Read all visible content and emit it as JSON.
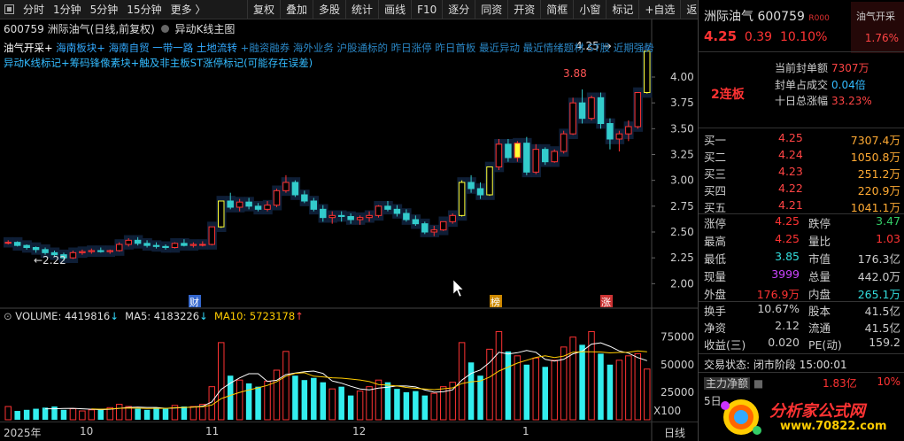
{
  "toolbar": {
    "periods": [
      "分时",
      "1分钟",
      "5分钟",
      "15分钟",
      "更多 〉"
    ],
    "buttons": [
      "复权",
      "叠加",
      "多股",
      "统计",
      "画线",
      "F10",
      "逐分",
      "同资",
      "开资",
      "简框",
      "小窗",
      "标记",
      "+自选",
      "返回"
    ]
  },
  "chart": {
    "title_code": "600759",
    "title_name": "洲际油气(日线,前复权)",
    "indicator": "异动K线主图",
    "concepts_row1": [
      {
        "text": "油气开采+",
        "color": "#ffffff"
      },
      {
        "text": "海南板块+",
        "color": "#33aaff"
      },
      {
        "text": "海南自贸 ",
        "color": "#33aaff"
      },
      {
        "text": "一带一路 ",
        "color": "#33aaff"
      },
      {
        "text": "土地流转",
        "color": "#33aaff"
      },
      {
        "text": "+融资融券 海外业务 沪股通标的 昨日涨停 昨日首板 最近异动 最近情绪题材 ST股 近期强势",
        "color": "#2a86c4"
      }
    ],
    "concepts_row2": "异动K线标记+筹码锋像素块+触及非主板ST涨停标记(可能存在误差)",
    "max_label": "4.25",
    "peak_label": "3.88",
    "low_label": "2.22",
    "event_labels": [
      "财",
      "榜",
      "涨"
    ],
    "price_ticks": [
      "4.00",
      "3.75",
      "3.50",
      "3.25",
      "3.00",
      "2.75",
      "2.50",
      "2.25",
      "2.00"
    ],
    "volume": {
      "label": "VOLUME:",
      "value": "4419816",
      "ma5_label": "MA5:",
      "ma5": "4183226",
      "ma10_label": "MA10:",
      "ma10": "5723178",
      "ticks": [
        "75000",
        "50000",
        "25000"
      ],
      "unit": "X100"
    },
    "date_ticks": [
      "2025年",
      "10",
      "11",
      "12",
      "1"
    ],
    "date_unit": "日线"
  },
  "chart_data": {
    "type": "candlestick",
    "symbol": "600759",
    "ylim": [
      1.9,
      4.3
    ],
    "candles": [
      [
        2.4,
        2.42,
        2.38,
        2.4
      ],
      [
        2.4,
        2.41,
        2.36,
        2.37
      ],
      [
        2.37,
        2.38,
        2.33,
        2.35
      ],
      [
        2.35,
        2.36,
        2.3,
        2.33
      ],
      [
        2.33,
        2.35,
        2.28,
        2.3
      ],
      [
        2.3,
        2.32,
        2.26,
        2.28
      ],
      [
        2.28,
        2.3,
        2.22,
        2.25
      ],
      [
        2.25,
        2.32,
        2.24,
        2.3
      ],
      [
        2.3,
        2.33,
        2.28,
        2.31
      ],
      [
        2.31,
        2.34,
        2.29,
        2.32
      ],
      [
        2.32,
        2.35,
        2.3,
        2.31
      ],
      [
        2.31,
        2.33,
        2.29,
        2.32
      ],
      [
        2.32,
        2.4,
        2.31,
        2.38
      ],
      [
        2.38,
        2.44,
        2.36,
        2.42
      ],
      [
        2.42,
        2.45,
        2.37,
        2.39
      ],
      [
        2.39,
        2.42,
        2.35,
        2.37
      ],
      [
        2.37,
        2.4,
        2.34,
        2.36
      ],
      [
        2.36,
        2.38,
        2.33,
        2.35
      ],
      [
        2.35,
        2.4,
        2.34,
        2.39
      ],
      [
        2.39,
        2.43,
        2.36,
        2.37
      ],
      [
        2.37,
        2.4,
        2.35,
        2.38
      ],
      [
        2.38,
        2.41,
        2.36,
        2.38
      ],
      [
        2.38,
        2.55,
        2.37,
        2.55
      ],
      [
        2.55,
        2.8,
        2.54,
        2.8
      ],
      [
        2.8,
        2.88,
        2.72,
        2.74
      ],
      [
        2.74,
        2.82,
        2.7,
        2.79
      ],
      [
        2.79,
        2.83,
        2.72,
        2.75
      ],
      [
        2.75,
        2.78,
        2.7,
        2.72
      ],
      [
        2.72,
        2.8,
        2.7,
        2.76
      ],
      [
        2.76,
        2.92,
        2.74,
        2.9
      ],
      [
        2.9,
        3.05,
        2.88,
        2.98
      ],
      [
        2.98,
        3.0,
        2.84,
        2.86
      ],
      [
        2.86,
        2.9,
        2.78,
        2.8
      ],
      [
        2.8,
        2.83,
        2.7,
        2.72
      ],
      [
        2.72,
        2.76,
        2.6,
        2.64
      ],
      [
        2.64,
        2.7,
        2.58,
        2.66
      ],
      [
        2.66,
        2.7,
        2.6,
        2.65
      ],
      [
        2.65,
        2.68,
        2.58,
        2.62
      ],
      [
        2.62,
        2.66,
        2.57,
        2.64
      ],
      [
        2.64,
        2.7,
        2.6,
        2.66
      ],
      [
        2.66,
        2.76,
        2.64,
        2.75
      ],
      [
        2.75,
        2.8,
        2.7,
        2.72
      ],
      [
        2.72,
        2.76,
        2.65,
        2.68
      ],
      [
        2.68,
        2.72,
        2.6,
        2.62
      ],
      [
        2.62,
        2.66,
        2.56,
        2.58
      ],
      [
        2.58,
        2.6,
        2.48,
        2.5
      ],
      [
        2.5,
        2.56,
        2.46,
        2.52
      ],
      [
        2.52,
        2.6,
        2.51,
        2.6
      ],
      [
        2.6,
        2.68,
        2.58,
        2.66
      ],
      [
        2.66,
        3.0,
        2.65,
        2.98
      ],
      [
        2.98,
        3.05,
        2.88,
        2.92
      ],
      [
        2.92,
        2.98,
        2.82,
        2.86
      ],
      [
        2.86,
        3.13,
        2.85,
        3.13
      ],
      [
        3.13,
        3.4,
        3.1,
        3.35
      ],
      [
        3.35,
        3.4,
        3.18,
        3.22
      ],
      [
        3.22,
        3.38,
        3.18,
        3.36
      ],
      [
        3.36,
        3.42,
        3.05,
        3.08
      ],
      [
        3.08,
        3.35,
        3.06,
        3.3
      ],
      [
        3.3,
        3.32,
        3.15,
        3.18
      ],
      [
        3.18,
        3.3,
        3.17,
        3.28
      ],
      [
        3.28,
        3.48,
        3.26,
        3.45
      ],
      [
        3.45,
        3.8,
        3.44,
        3.75
      ],
      [
        3.75,
        3.88,
        3.55,
        3.6
      ],
      [
        3.6,
        3.82,
        3.58,
        3.8
      ],
      [
        3.8,
        3.85,
        3.5,
        3.55
      ],
      [
        3.55,
        3.6,
        3.3,
        3.4
      ],
      [
        3.4,
        3.48,
        3.28,
        3.45
      ],
      [
        3.45,
        3.58,
        3.38,
        3.52
      ],
      [
        3.52,
        3.85,
        3.5,
        3.85
      ],
      [
        3.85,
        4.25,
        3.84,
        4.25
      ]
    ],
    "volumes": [
      12,
      8,
      9,
      10,
      11,
      12,
      9,
      10,
      8,
      9,
      10,
      11,
      14,
      12,
      10,
      9,
      11,
      10,
      13,
      12,
      12,
      14,
      30,
      70,
      40,
      36,
      33,
      30,
      35,
      45,
      62,
      40,
      36,
      38,
      34,
      28,
      30,
      22,
      26,
      30,
      36,
      34,
      28,
      25,
      26,
      22,
      24,
      30,
      34,
      70,
      52,
      40,
      64,
      80,
      62,
      58,
      50,
      56,
      48,
      54,
      66,
      75,
      68,
      80,
      60,
      50,
      54,
      58,
      60,
      46
    ],
    "volume_ylim": [
      0,
      90000
    ]
  },
  "panel": {
    "name": "洲际油气",
    "code": "600759",
    "badge": "R",
    "badge_small": "000",
    "tag_name": "油气开采",
    "tag_change": "1.76%",
    "price": "4.25",
    "change": "0.39",
    "change_pct": "10.10%",
    "streak": "2连板",
    "seal_amount_label": "当前封单额",
    "seal_amount": "7307万",
    "seal_ratio_label": "封单占成交",
    "seal_ratio": "0.04倍",
    "ten_day_label": "十日总涨幅",
    "ten_day": "33.23%",
    "orderbook": [
      {
        "label": "买一",
        "price": "4.25",
        "vol": "7307.4万"
      },
      {
        "label": "买二",
        "price": "4.24",
        "vol": "1050.8万"
      },
      {
        "label": "买三",
        "price": "4.23",
        "vol": "251.2万"
      },
      {
        "label": "买四",
        "price": "4.22",
        "vol": "220.9万"
      },
      {
        "label": "买五",
        "price": "4.21",
        "vol": "1041.1万"
      }
    ],
    "quotes1": [
      {
        "l": "涨停",
        "lv": "4.25",
        "lc": "red",
        "r": "跌停",
        "rv": "3.47",
        "rc": "green"
      },
      {
        "l": "最高",
        "lv": "4.25",
        "lc": "red",
        "r": "量比",
        "rv": "1.03",
        "rc": "red"
      },
      {
        "l": "最低",
        "lv": "3.85",
        "lc": "cyan",
        "r": "市值",
        "rv": "176.3亿",
        "rc": "white"
      },
      {
        "l": "现量",
        "lv": "3999",
        "lc": "purple",
        "r": "总量",
        "rv": "442.0万",
        "rc": "white"
      },
      {
        "l": "外盘",
        "lv": "176.9万",
        "lc": "red",
        "r": "内盘",
        "rv": "265.1万",
        "rc": "cyan"
      }
    ],
    "quotes2": [
      {
        "l": "换手",
        "lv": "10.67%",
        "lc": "white",
        "r": "股本",
        "rv": "41.5亿",
        "rc": "white"
      },
      {
        "l": "净资",
        "lv": "2.12",
        "lc": "white",
        "r": "流通",
        "rv": "41.5亿",
        "rc": "white"
      },
      {
        "l": "收益(三)",
        "lv": "0.020",
        "lc": "white",
        "r": "PE(动)",
        "rv": "159.2",
        "rc": "white"
      }
    ],
    "status_label": "交易状态:",
    "status": "闭市阶段 15:00:01",
    "main_flow_label": "主力净额",
    "main_flow": "1.83亿",
    "main_flow_pct": "10%",
    "main_flow_sub": "5日",
    "logo": "分析家公式网",
    "logo_url": "www.70822.com"
  }
}
